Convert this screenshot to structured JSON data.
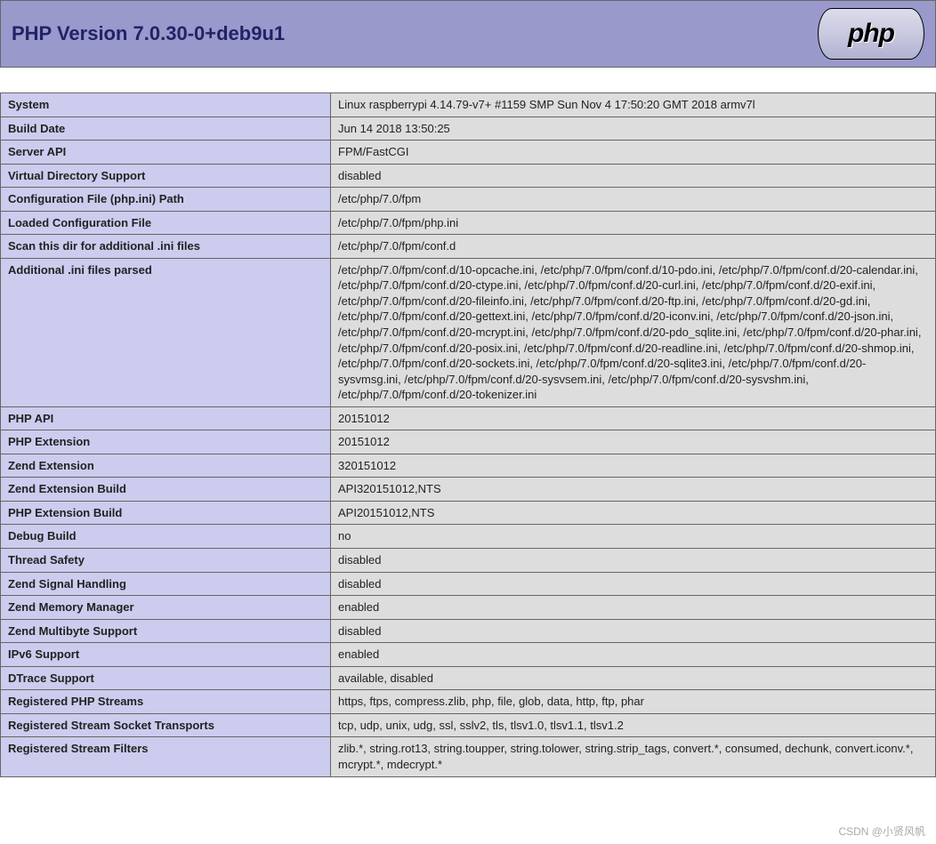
{
  "header": {
    "title": "PHP Version 7.0.30-0+deb9u1",
    "logo_text": "php"
  },
  "rows": [
    {
      "key": "System",
      "val": "Linux raspberrypi 4.14.79-v7+ #1159 SMP Sun Nov 4 17:50:20 GMT 2018 armv7l"
    },
    {
      "key": "Build Date",
      "val": "Jun 14 2018 13:50:25"
    },
    {
      "key": "Server API",
      "val": "FPM/FastCGI"
    },
    {
      "key": "Virtual Directory Support",
      "val": "disabled"
    },
    {
      "key": "Configuration File (php.ini) Path",
      "val": "/etc/php/7.0/fpm"
    },
    {
      "key": "Loaded Configuration File",
      "val": "/etc/php/7.0/fpm/php.ini"
    },
    {
      "key": "Scan this dir for additional .ini files",
      "val": "/etc/php/7.0/fpm/conf.d"
    },
    {
      "key": "Additional .ini files parsed",
      "val": "/etc/php/7.0/fpm/conf.d/10-opcache.ini, /etc/php/7.0/fpm/conf.d/10-pdo.ini, /etc/php/7.0/fpm/conf.d/20-calendar.ini, /etc/php/7.0/fpm/conf.d/20-ctype.ini, /etc/php/7.0/fpm/conf.d/20-curl.ini, /etc/php/7.0/fpm/conf.d/20-exif.ini, /etc/php/7.0/fpm/conf.d/20-fileinfo.ini, /etc/php/7.0/fpm/conf.d/20-ftp.ini, /etc/php/7.0/fpm/conf.d/20-gd.ini, /etc/php/7.0/fpm/conf.d/20-gettext.ini, /etc/php/7.0/fpm/conf.d/20-iconv.ini, /etc/php/7.0/fpm/conf.d/20-json.ini, /etc/php/7.0/fpm/conf.d/20-mcrypt.ini, /etc/php/7.0/fpm/conf.d/20-pdo_sqlite.ini, /etc/php/7.0/fpm/conf.d/20-phar.ini, /etc/php/7.0/fpm/conf.d/20-posix.ini, /etc/php/7.0/fpm/conf.d/20-readline.ini, /etc/php/7.0/fpm/conf.d/20-shmop.ini, /etc/php/7.0/fpm/conf.d/20-sockets.ini, /etc/php/7.0/fpm/conf.d/20-sqlite3.ini, /etc/php/7.0/fpm/conf.d/20-sysvmsg.ini, /etc/php/7.0/fpm/conf.d/20-sysvsem.ini, /etc/php/7.0/fpm/conf.d/20-sysvshm.ini, /etc/php/7.0/fpm/conf.d/20-tokenizer.ini"
    },
    {
      "key": "PHP API",
      "val": "20151012"
    },
    {
      "key": "PHP Extension",
      "val": "20151012"
    },
    {
      "key": "Zend Extension",
      "val": "320151012"
    },
    {
      "key": "Zend Extension Build",
      "val": "API320151012,NTS"
    },
    {
      "key": "PHP Extension Build",
      "val": "API20151012,NTS"
    },
    {
      "key": "Debug Build",
      "val": "no"
    },
    {
      "key": "Thread Safety",
      "val": "disabled"
    },
    {
      "key": "Zend Signal Handling",
      "val": "disabled"
    },
    {
      "key": "Zend Memory Manager",
      "val": "enabled"
    },
    {
      "key": "Zend Multibyte Support",
      "val": "disabled"
    },
    {
      "key": "IPv6 Support",
      "val": "enabled"
    },
    {
      "key": "DTrace Support",
      "val": "available, disabled"
    },
    {
      "key": "Registered PHP Streams",
      "val": "https, ftps, compress.zlib, php, file, glob, data, http, ftp, phar"
    },
    {
      "key": "Registered Stream Socket Transports",
      "val": "tcp, udp, unix, udg, ssl, sslv2, tls, tlsv1.0, tlsv1.1, tlsv1.2"
    },
    {
      "key": "Registered Stream Filters",
      "val": "zlib.*, string.rot13, string.toupper, string.tolower, string.strip_tags, convert.*, consumed, dechunk, convert.iconv.*, mcrypt.*, mdecrypt.*"
    }
  ],
  "watermark": "CSDN @小贤风帆"
}
